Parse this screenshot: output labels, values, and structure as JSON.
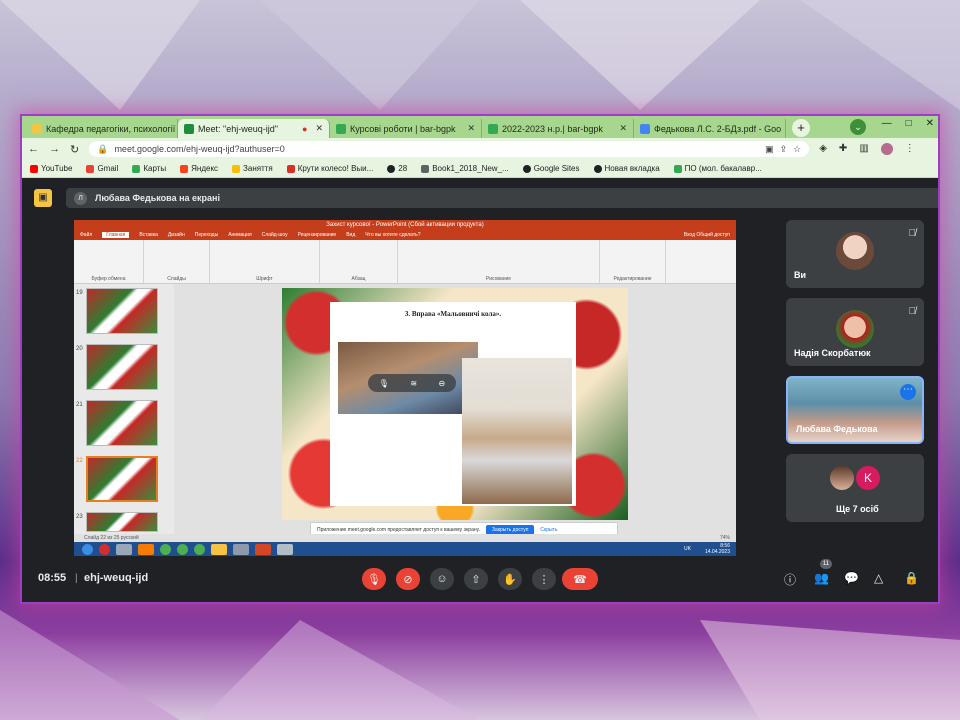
{
  "browser": {
    "tabs": [
      {
        "label": "Кафедра педагогіки, психології",
        "color": "#f4c542",
        "active": false
      },
      {
        "label": "Meet: \"ehj-weuq-ijd\"",
        "color": "#1e8e3e",
        "active": true
      },
      {
        "label": "Курсові роботи | bar-bgpk",
        "color": "#34a853",
        "active": false
      },
      {
        "label": "2022-2023 н.р.| bar-bgpk",
        "color": "#34a853",
        "active": false
      },
      {
        "label": "Федькова Л.С. 2-БДз.pdf - Goo",
        "color": "#4285f4",
        "active": false
      }
    ],
    "new_tab": "+",
    "url": "meet.google.com/ehj-weuq-ijd?authuser=0",
    "bookmarks": [
      {
        "label": "YouTube",
        "color": "#ff0000"
      },
      {
        "label": "Gmail",
        "color": "#ea4335"
      },
      {
        "label": "Карты",
        "color": "#34a853"
      },
      {
        "label": "Яндекс",
        "color": "#fc3f1d"
      },
      {
        "label": "Заняття",
        "color": "#fbbc04"
      },
      {
        "label": "Крути колесо! Выи...",
        "color": "#d93025"
      },
      {
        "label": "28",
        "color": "#202124"
      },
      {
        "label": "Book1_2018_New_...",
        "color": "#5f6368"
      },
      {
        "label": "Google Sites",
        "color": "#202124"
      },
      {
        "label": "Новая вкладка",
        "color": "#202124"
      },
      {
        "label": "ПО (мол. бакалавр...",
        "color": "#34a853"
      }
    ]
  },
  "meet": {
    "presenting_initial": "Л",
    "presenting_label": "Любава Федькова на екрані",
    "time": "08:55",
    "separator": "|",
    "meeting_code": "ehj-weuq-ijd",
    "participants_count": "11",
    "participants": [
      {
        "name": "Ви"
      },
      {
        "name": "Надія Скорбатюк"
      },
      {
        "name": "Любава Федькова"
      },
      {
        "name": "Ще 7 осіб",
        "initial": "K"
      }
    ]
  },
  "shared_screen": {
    "window_title": "Захист курсової - PowerPoint (Сбой активации продукта)",
    "ribbon_tabs": [
      "Файл",
      "Главная",
      "Вставка",
      "Дизайн",
      "Переходы",
      "Анимация",
      "Слайд-шоу",
      "Рецензирование",
      "Вид",
      "Что вы хотите сделать?"
    ],
    "ribbon_right": "Вход  Общий доступ",
    "ribbon_groups": [
      "Буфер обмена",
      "Слайды",
      "Шрифт",
      "Абзац",
      "Рисование",
      "Редактирование"
    ],
    "thumb_numbers": [
      "19",
      "20",
      "21",
      "22",
      "23"
    ],
    "slide_title": "3. Вправа «Мальовничі кола».",
    "status_text": "Слайд 22 из 25   русский",
    "notification": "Приложение meet.google.com предоставляет доступ к вашему экрану.",
    "notification_button": "Закрыть доступ",
    "notification_link": "Скрыть",
    "clock_time": "8:56",
    "clock_date": "14.04.2023",
    "lang": "UK",
    "zoom": "74%"
  }
}
